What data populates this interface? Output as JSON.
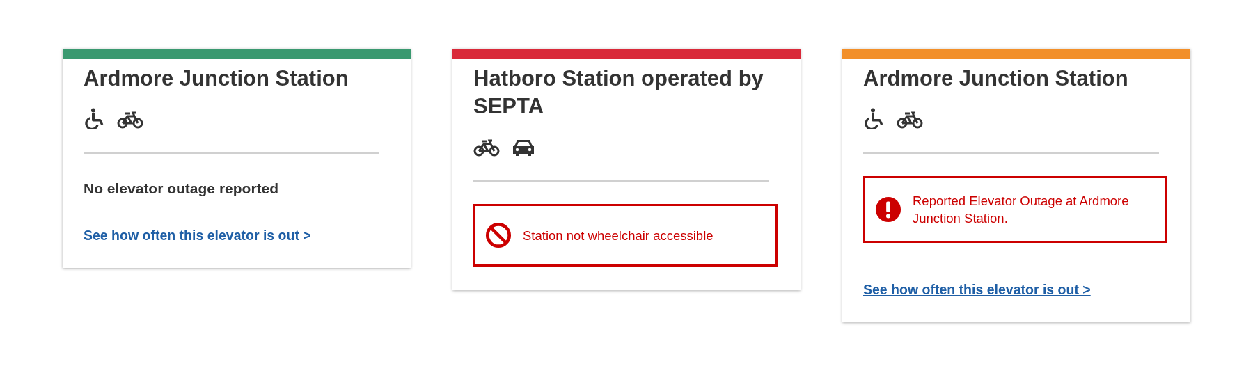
{
  "cards": [
    {
      "color": "#3a9970",
      "title": "Ardmore Junction Station",
      "amenities": [
        {
          "kind": "wheelchair"
        },
        {
          "kind": "bicycle"
        }
      ],
      "status": {
        "kind": "notice",
        "text": "No elevator outage reported"
      },
      "link": "See how often this elevator is out >"
    },
    {
      "color": "#d92939",
      "title": "Hatboro Station operated by SEPTA",
      "amenities": [
        {
          "kind": "bicycle"
        },
        {
          "kind": "parking"
        }
      ],
      "status": {
        "kind": "blocked",
        "text": "Station not wheelchair accessible"
      }
    },
    {
      "color": "#f28f29",
      "title": "Ardmore Junction Station",
      "amenities": [
        {
          "kind": "wheelchair"
        },
        {
          "kind": "bicycle"
        }
      ],
      "status": {
        "kind": "outage",
        "text": "Reported Elevator Outage at Ardmore Junction Station."
      },
      "link": "See how often this elevator is out >"
    }
  ]
}
